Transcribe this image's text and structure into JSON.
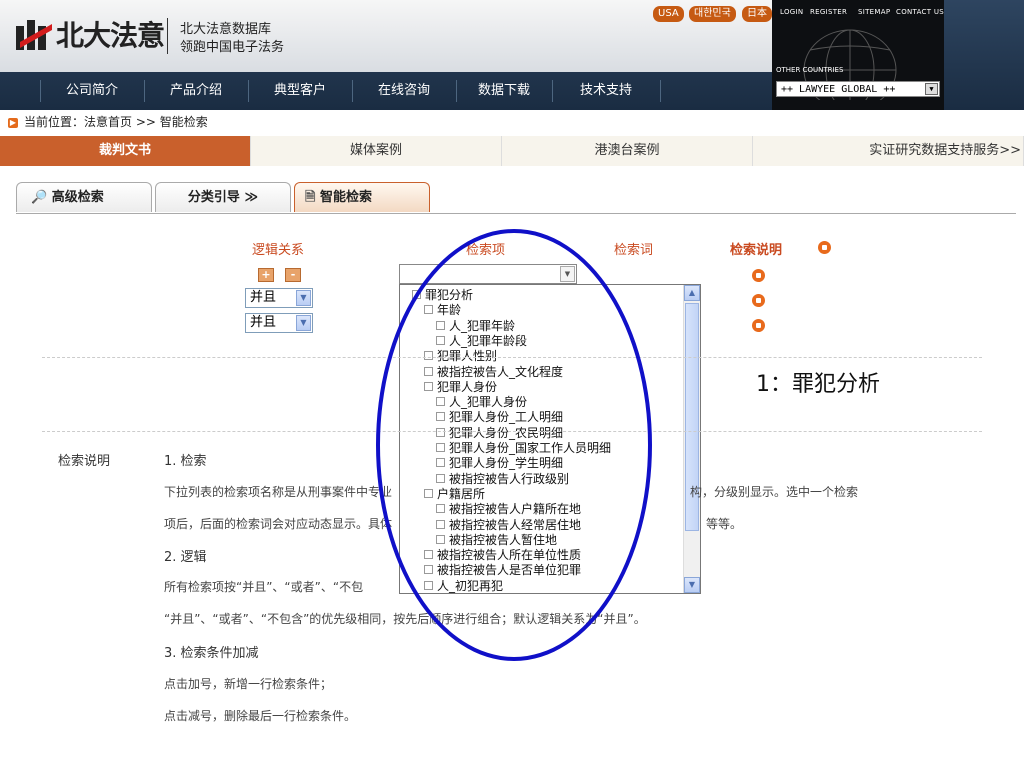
{
  "header": {
    "logo_text": "北大法意",
    "slogan_line1": "北大法意数据库",
    "slogan_line2": "领跑中国电子法务",
    "languages": [
      "USA",
      "대한민국",
      "日本"
    ],
    "top_links": [
      "LOGIN",
      "REGISTER",
      "SITEMAP",
      "CONTACT US"
    ],
    "other_countries": "OTHER COUNTRIES",
    "lawyee_select": "++ LAWYEE GLOBAL ++",
    "nav": [
      "公司简介",
      "产品介绍",
      "典型客户",
      "在线咨询",
      "数据下载",
      "技术支持"
    ]
  },
  "breadcrumb": "当前位置：法意首页 >> 智能检索",
  "tabs": [
    "裁判文书",
    "媒体案例",
    "港澳台案例",
    "实证研究数据支持服务>>"
  ],
  "subtabs": [
    "高级检索",
    "分类引导",
    "智能检索"
  ],
  "form": {
    "col_logic": "逻辑关系",
    "col_item": "检索项",
    "col_word": "检索词",
    "col_help": "检索说明",
    "plus": "+",
    "minus": "-",
    "logic_values": [
      "并且",
      "并且"
    ]
  },
  "tree": [
    {
      "label": "罪犯分析",
      "level": 0
    },
    {
      "label": "年龄",
      "level": 1
    },
    {
      "label": "人_犯罪年龄",
      "level": 2
    },
    {
      "label": "人_犯罪年龄段",
      "level": 2
    },
    {
      "label": "犯罪人性别",
      "level": 1
    },
    {
      "label": "被指控被告人_文化程度",
      "level": 1
    },
    {
      "label": "犯罪人身份",
      "level": 1
    },
    {
      "label": "人_犯罪人身份",
      "level": 2
    },
    {
      "label": "犯罪人身份_工人明细",
      "level": 2
    },
    {
      "label": "犯罪人身份_农民明细",
      "level": 2
    },
    {
      "label": "犯罪人身份_国家工作人员明细",
      "level": 2
    },
    {
      "label": "犯罪人身份_学生明细",
      "level": 2
    },
    {
      "label": "被指控被告人行政级别",
      "level": 2
    },
    {
      "label": "户籍居所",
      "level": 1
    },
    {
      "label": "被指控被告人户籍所在地",
      "level": 2
    },
    {
      "label": "被指控被告人经常居住地",
      "level": 2
    },
    {
      "label": "被指控被告人暂住地",
      "level": 2
    },
    {
      "label": "被指控被告人所在单位性质",
      "level": 1
    },
    {
      "label": "被指控被告人是否单位犯罪",
      "level": 1
    },
    {
      "label": "人_初犯再犯",
      "level": 1
    }
  ],
  "callout": "1：罪犯分析",
  "help": {
    "title": "检索说明",
    "h1": "1. 检索",
    "p1a": "下拉列表的检索项名称是从刑事案件中专业",
    "p1b": "构，分级别显示。选中一个检索",
    "p2a": "项后，后面的检索词会对应动态显示。具体",
    "p2b": "等等。",
    "h2": "2. 逻辑",
    "p3": "所有检索项按“并且”、“或者”、“不包",
    "p4": "“并且”、“或者”、“不包含”的优先级相同，按先后顺序进行组合；默认逻辑关系为“并且”。",
    "h3": "3. 检索条件加减",
    "p5": "点击加号，新增一行检索条件；",
    "p6": "点击减号，删除最后一行检索条件。"
  }
}
